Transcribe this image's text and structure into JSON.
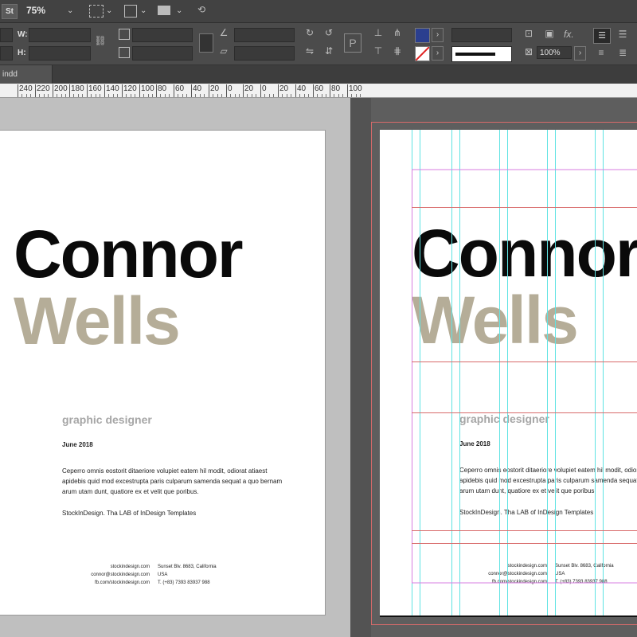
{
  "app": {
    "logo": "St",
    "zoom": "75%",
    "tab_name": "indd"
  },
  "control": {
    "w_label": "W:",
    "h_label": "H:",
    "scale_value": "100%",
    "fx_label": "fx."
  },
  "ruler": {
    "labels": [
      "240",
      "220",
      "200",
      "180",
      "160",
      "140",
      "120",
      "100",
      "80",
      "60",
      "40",
      "20",
      "0",
      "20",
      "0",
      "20",
      "40",
      "60",
      "80",
      "100"
    ]
  },
  "document": {
    "first_name": "Connor",
    "last_name": "Wells",
    "role": "graphic designer",
    "date": "June 2018",
    "body_line1": "Ceperro omnis eostorit ditaeriore volupiet eatem hil modit, odiorat atiaest",
    "body_line2": "apidebis quid mod excestrupta paris culparum samenda sequat a quo bernam",
    "body_line3": "arum utam dunt, quatiore ex et velit que poribus.",
    "tagline": "StockInDesign. Tha LAB of InDesign Templates",
    "web": "stockindesign.com",
    "email": "connor@stockindesign.com",
    "fb": "fb.com/stockindesign.com",
    "address": "Sunset Blv. 8683, California",
    "country": "USA",
    "phone": "T. (+83) 7393 83937 988"
  },
  "colors": {
    "accent_tan": "#b5ad98",
    "guide_cyan": "#5fe3e3",
    "guide_magenta": "#d77ee0",
    "guide_red": "#d86a6a"
  },
  "icons": [
    "chain-link-icon",
    "rotate-icon",
    "flip-icon",
    "paragraph-icon",
    "fill-swatch-icon",
    "stroke-swatch-icon",
    "text-frame-icon",
    "fx-icon"
  ]
}
